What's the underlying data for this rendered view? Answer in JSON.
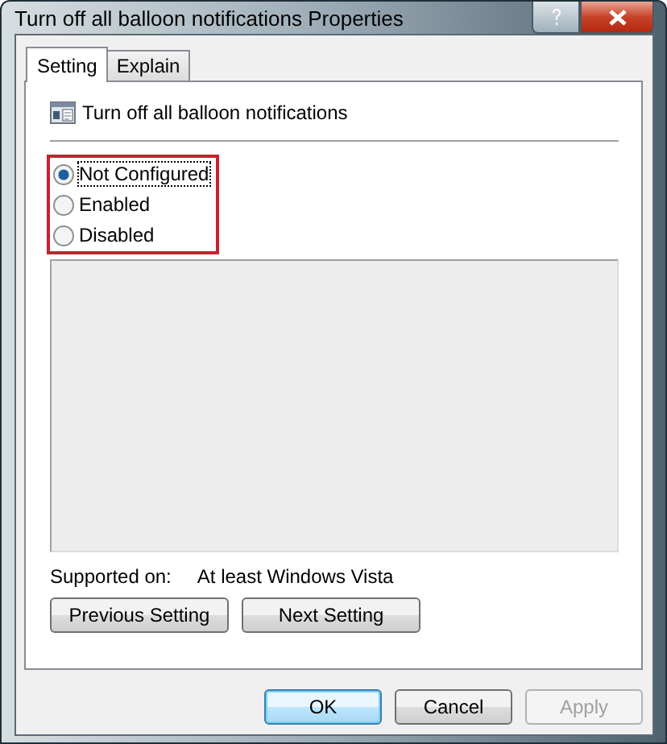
{
  "window": {
    "title": "Turn off all balloon notifications Properties"
  },
  "tabs": [
    {
      "label": "Setting",
      "selected": true
    },
    {
      "label": "Explain",
      "selected": false
    }
  ],
  "setting_title": "Turn off all balloon notifications",
  "options": [
    {
      "label": "Not Configured",
      "selected": true
    },
    {
      "label": "Enabled",
      "selected": false
    },
    {
      "label": "Disabled",
      "selected": false
    }
  ],
  "supported_on": {
    "label": "Supported on:",
    "value": "At least Windows Vista"
  },
  "nav_buttons": [
    {
      "label": "Previous Setting"
    },
    {
      "label": "Next Setting"
    }
  ],
  "buttons": [
    {
      "label": "OK",
      "default": true,
      "disabled": false
    },
    {
      "label": "Cancel",
      "default": false,
      "disabled": false
    },
    {
      "label": "Apply",
      "default": false,
      "disabled": true
    }
  ]
}
